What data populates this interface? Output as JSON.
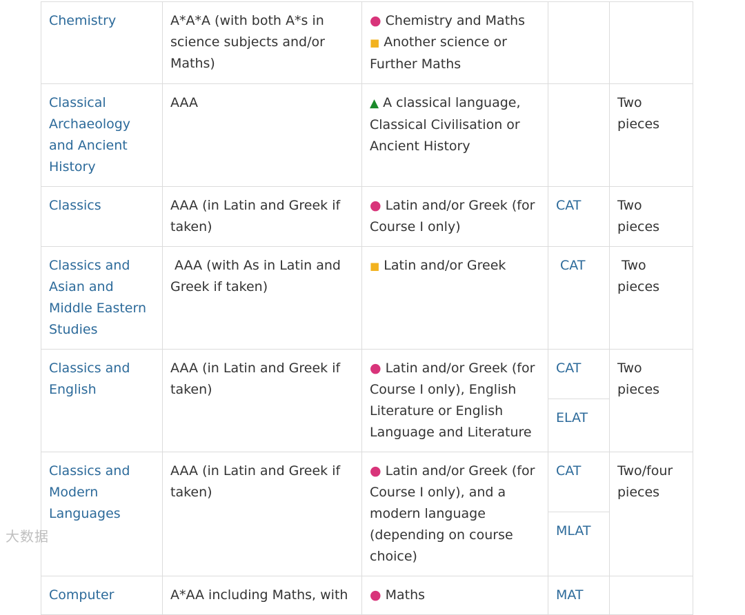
{
  "legend_symbols": {
    "essential": "●",
    "recommended": "■",
    "helpful": "▲"
  },
  "rows": [
    {
      "course": "Chemistry",
      "offer": "A*A*A (with both A*s in science subjects and/or Maths)",
      "subjects": [
        {
          "marker": "essential",
          "text": "Chemistry and Maths"
        },
        {
          "marker": "recommended",
          "text": "Another science or Further Maths"
        }
      ],
      "tests": [],
      "written_work": ""
    },
    {
      "course": "Classical Archaeology and Ancient History",
      "offer": "AAA",
      "subjects": [
        {
          "marker": "helpful",
          "text": "A classical language, Classical Civilisation or Ancient History"
        }
      ],
      "tests": [],
      "written_work": "Two pieces"
    },
    {
      "course": "Classics",
      "offer": "AAA (in Latin and Greek if taken)",
      "subjects": [
        {
          "marker": "essential",
          "text": "Latin and/or Greek (for Course I only)"
        }
      ],
      "tests": [
        "CAT"
      ],
      "written_work": "Two pieces"
    },
    {
      "course": "Classics and Asian and Middle Eastern Studies",
      "offer": " AAA (with As in Latin and Greek if taken)",
      "subjects": [
        {
          "marker": "recommended",
          "text": "Latin and/or Greek"
        }
      ],
      "tests": [
        " CAT"
      ],
      "written_work": " Two pieces"
    },
    {
      "course": "Classics and English",
      "offer": "AAA (in Latin and Greek if taken)",
      "subjects": [
        {
          "marker": "essential",
          "text": "Latin and/or Greek (for Course I only), English Literature or English Language and Literature"
        }
      ],
      "tests": [
        "CAT",
        "ELAT"
      ],
      "written_work": "Two pieces"
    },
    {
      "course": "Classics and Modern Languages",
      "offer": "AAA (in Latin and Greek if taken)",
      "subjects": [
        {
          "marker": "essential",
          "text": "Latin and/or Greek (for Course I only), and a modern language (depending on course choice)"
        }
      ],
      "tests": [
        "CAT",
        "MLAT"
      ],
      "written_work": "Two/four pieces"
    },
    {
      "course": "Computer",
      "offer": "A*AA including Maths, with",
      "subjects": [
        {
          "marker": "essential",
          "text": "Maths"
        }
      ],
      "tests": [
        "MAT"
      ],
      "written_work": ""
    }
  ],
  "watermark": "大数据"
}
